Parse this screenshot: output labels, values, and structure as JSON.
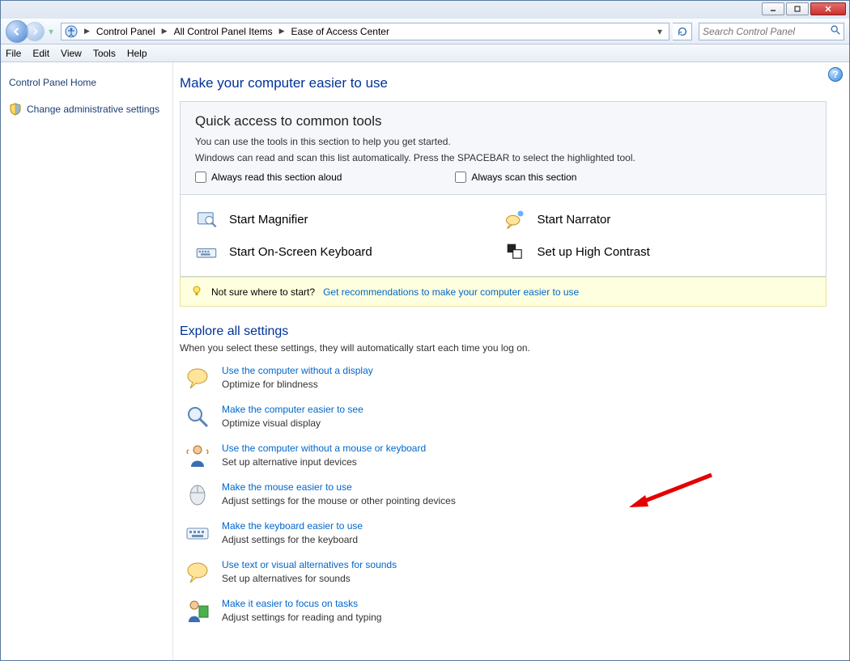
{
  "breadcrumbs": [
    "Control Panel",
    "All Control Panel Items",
    "Ease of Access Center"
  ],
  "search_placeholder": "Search Control Panel",
  "menus": [
    "File",
    "Edit",
    "View",
    "Tools",
    "Help"
  ],
  "sidebar": {
    "home": "Control Panel Home",
    "admin": "Change administrative settings"
  },
  "page_title": "Make your computer easier to use",
  "quick_panel": {
    "heading": "Quick access to common tools",
    "line1": "You can use the tools in this section to help you get started.",
    "line2": "Windows can read and scan this list automatically.  Press the SPACEBAR to select the highlighted tool.",
    "chk1": "Always read this section aloud",
    "chk2": "Always scan this section"
  },
  "tools": {
    "magnifier": "Start Magnifier",
    "narrator": "Start Narrator",
    "osk": "Start On-Screen Keyboard",
    "contrast": "Set up High Contrast"
  },
  "hint": {
    "lead": "Not sure where to start?",
    "link": "Get recommendations to make your computer easier to use"
  },
  "explore": {
    "heading": "Explore all settings",
    "desc": "When you select these settings, they will automatically start each time you log on."
  },
  "settings": [
    {
      "title": "Use the computer without a display",
      "desc": "Optimize for blindness"
    },
    {
      "title": "Make the computer easier to see",
      "desc": "Optimize visual display"
    },
    {
      "title": "Use the computer without a mouse or keyboard",
      "desc": "Set up alternative input devices"
    },
    {
      "title": "Make the mouse easier to use",
      "desc": "Adjust settings for the mouse or other pointing devices"
    },
    {
      "title": "Make the keyboard easier to use",
      "desc": "Adjust settings for the keyboard"
    },
    {
      "title": "Use text or visual alternatives for sounds",
      "desc": "Set up alternatives for sounds"
    },
    {
      "title": "Make it easier to focus on tasks",
      "desc": "Adjust settings for reading and typing"
    }
  ]
}
